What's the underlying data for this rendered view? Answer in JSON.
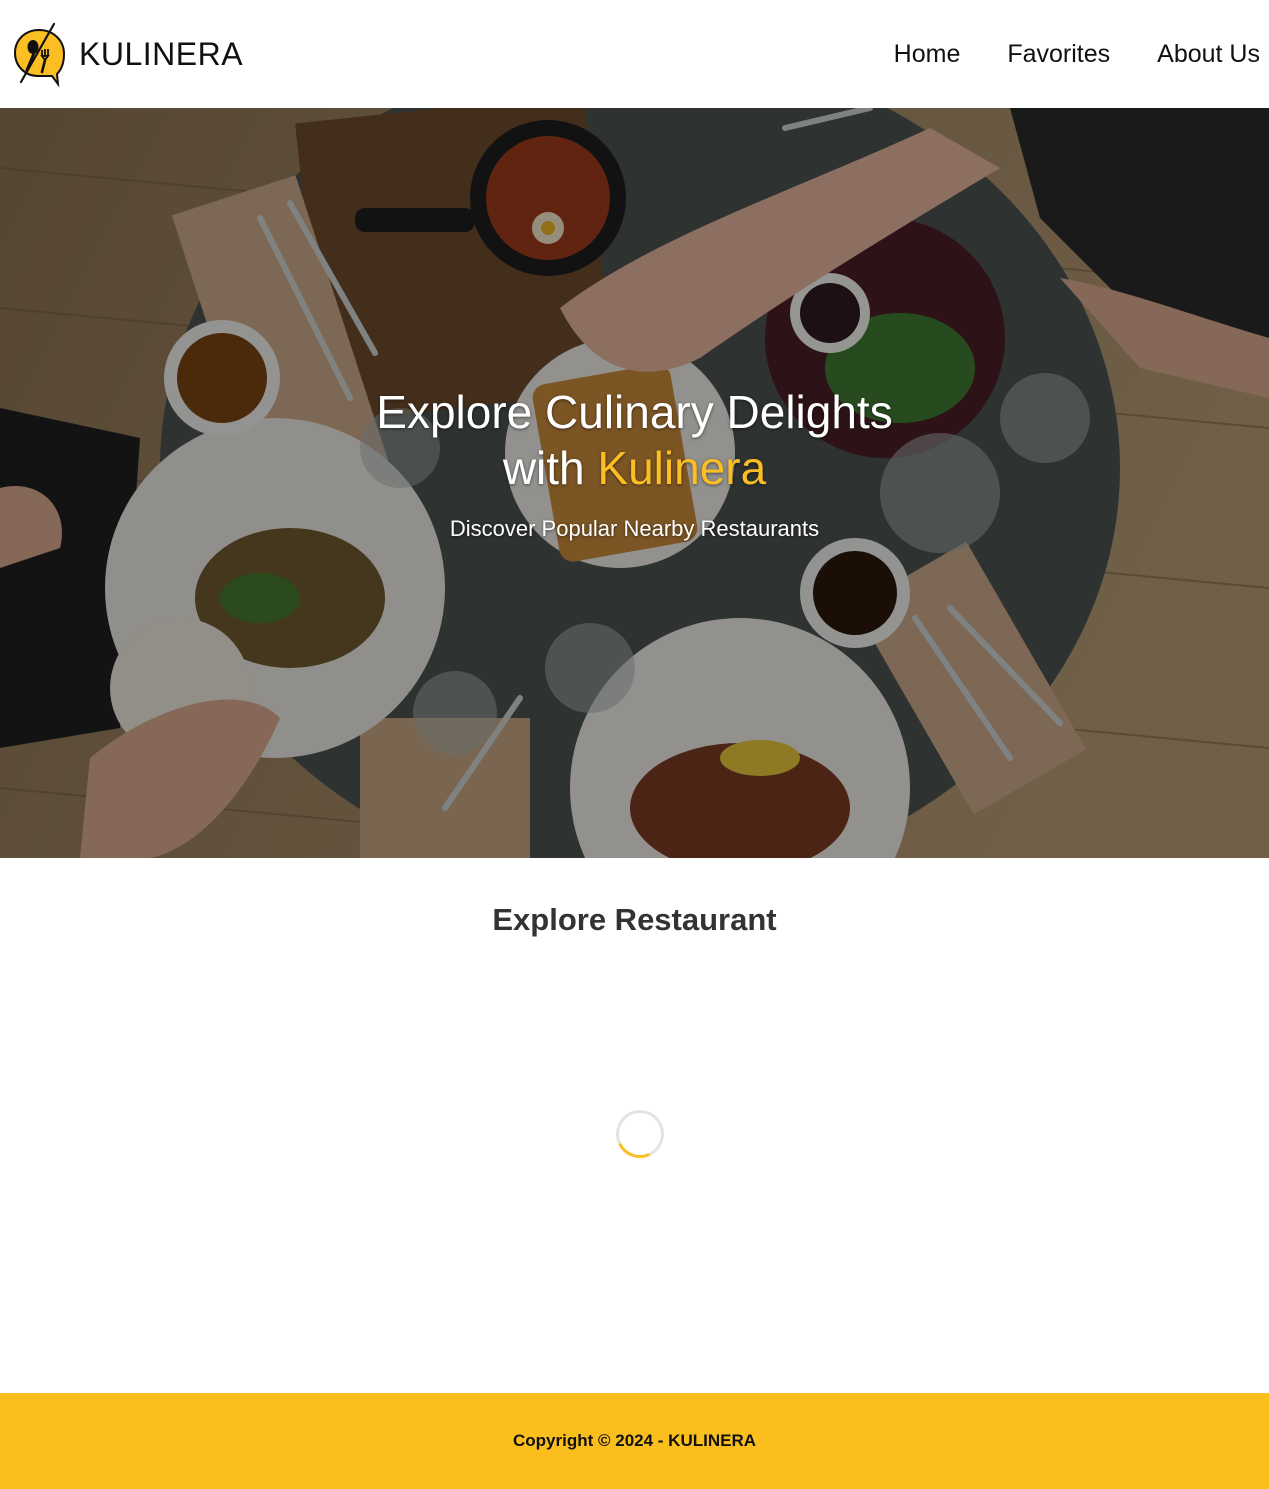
{
  "header": {
    "brand_name": "KULINERA",
    "nav": {
      "home": "Home",
      "favorites": "Favorites",
      "about": "About Us"
    }
  },
  "hero": {
    "title_line1": "Explore Culinary Delights",
    "title_prefix": "with",
    "title_accent": "Kulinera",
    "subtitle": "Discover Popular Nearby Restaurants"
  },
  "main": {
    "section_title": "Explore Restaurant"
  },
  "footer": {
    "copyright": "Copyright © 2024 - KULINERA"
  },
  "colors": {
    "accent": "#fbbf24",
    "footer_bg": "#fbbf1d",
    "text": "#111111",
    "heading": "#333333"
  }
}
